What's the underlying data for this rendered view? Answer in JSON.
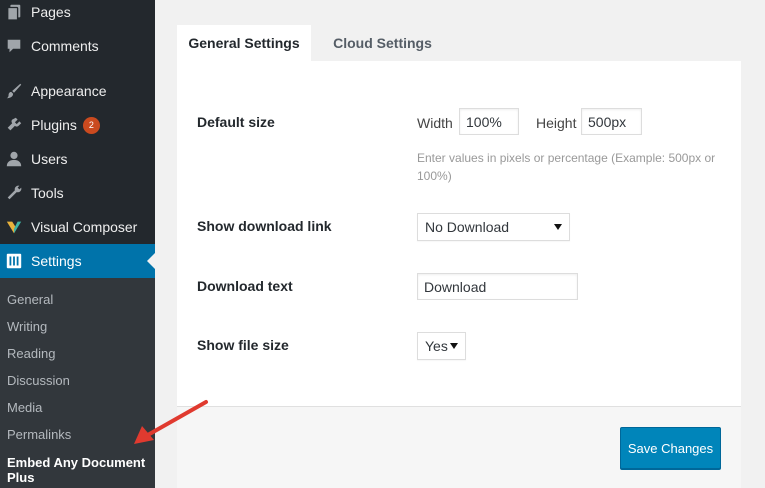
{
  "sidebar": {
    "items": [
      {
        "key": "pages",
        "label": "Pages",
        "icon": "pages-icon"
      },
      {
        "key": "comments",
        "label": "Comments",
        "icon": "comments-icon"
      },
      {
        "key": "appearance",
        "label": "Appearance",
        "icon": "brush-icon"
      },
      {
        "key": "plugins",
        "label": "Plugins",
        "icon": "plugin-icon",
        "badge": "2"
      },
      {
        "key": "users",
        "label": "Users",
        "icon": "users-icon"
      },
      {
        "key": "tools",
        "label": "Tools",
        "icon": "wrench-icon"
      },
      {
        "key": "visual-composer",
        "label": "Visual Composer",
        "icon": "visual-composer-icon"
      },
      {
        "key": "settings",
        "label": "Settings",
        "icon": "settings-icon",
        "active": true
      }
    ],
    "submenu": [
      {
        "label": "General"
      },
      {
        "label": "Writing"
      },
      {
        "label": "Reading"
      },
      {
        "label": "Discussion"
      },
      {
        "label": "Media"
      },
      {
        "label": "Permalinks"
      },
      {
        "label": "Embed Any Document Plus",
        "current": true
      }
    ]
  },
  "tabs": [
    {
      "label": "General Settings",
      "active": true
    },
    {
      "label": "Cloud Settings",
      "active": false
    }
  ],
  "form": {
    "default_size": {
      "label": "Default size",
      "width_label": "Width",
      "width_value": "100%",
      "height_label": "Height",
      "height_value": "500px",
      "hint": "Enter values in pixels or percentage (Example: 500px or 100%)"
    },
    "show_download_link": {
      "label": "Show download link",
      "value": "No Download"
    },
    "download_text": {
      "label": "Download text",
      "value": "Download"
    },
    "show_file_size": {
      "label": "Show file size",
      "value": "Yes"
    }
  },
  "save_button": {
    "label": "Save Changes"
  },
  "colors": {
    "sidebar_bg": "#23282d",
    "submenu_bg": "#32373c",
    "active_blue": "#0073aa",
    "button_blue": "#0085ba",
    "badge_orange": "#ca4a1f",
    "annotation_arrow": "#e03a2f"
  }
}
